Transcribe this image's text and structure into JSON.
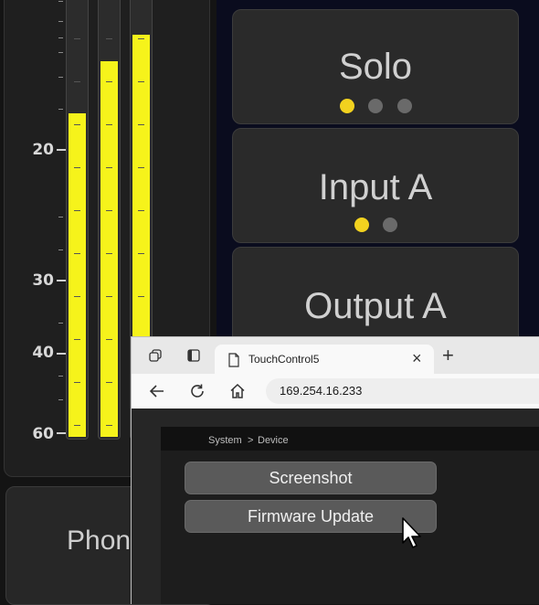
{
  "meter": {
    "scale_labels": [
      "20",
      "30",
      "40",
      "60"
    ],
    "levels": [
      0.74,
      0.86,
      0.92
    ]
  },
  "controls": {
    "solo": {
      "label": "Solo",
      "dots_active": 1,
      "dots_total": 3
    },
    "input_a": {
      "label": "Input A",
      "dots_active": 1,
      "dots_total": 2
    },
    "output_a": {
      "label": "Output A"
    }
  },
  "phones": {
    "label": "Phone"
  },
  "browser": {
    "tab_title": "TouchControl5",
    "close_label": "×",
    "new_tab_label": "+",
    "url": "169.254.16.233",
    "breadcrumb": {
      "root": "System",
      "separator": ">",
      "current": "Device"
    },
    "buttons": {
      "screenshot": "Screenshot",
      "firmware_update": "Firmware Update"
    }
  },
  "colors": {
    "meter_fill": "#f6f31b",
    "active_dot": "#f2d21f",
    "inactive_dot": "#6a6a6a",
    "panel_bg": "#0a0c1e"
  },
  "icons": [
    "collections-icon",
    "tab-actions-icon",
    "page-icon",
    "back-arrow-icon",
    "reload-icon",
    "home-icon",
    "mouse-cursor-icon"
  ]
}
